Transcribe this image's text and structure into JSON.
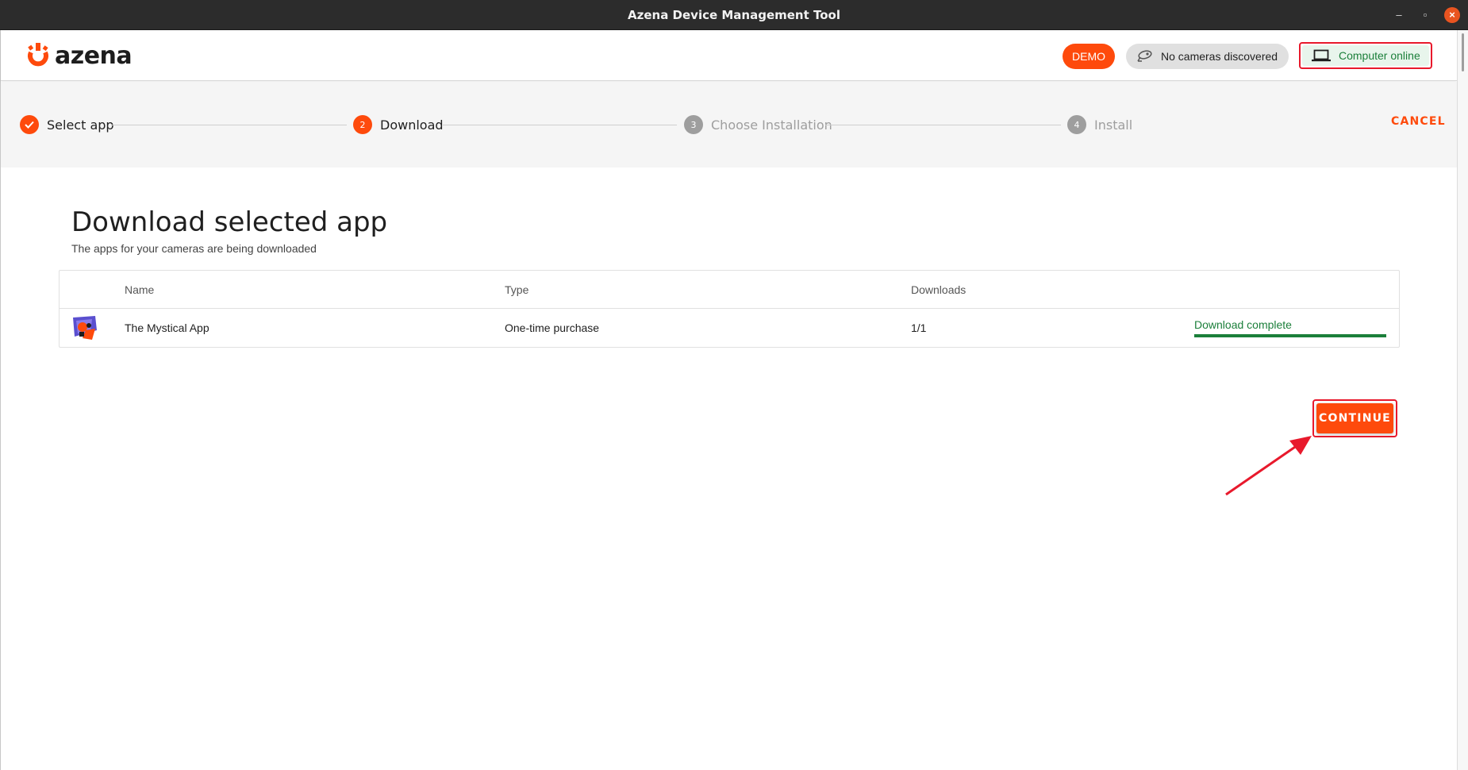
{
  "window": {
    "title": "Azena Device Management Tool",
    "controls": [
      "minimize-icon",
      "restore-icon",
      "close-icon"
    ]
  },
  "header": {
    "logo_text": "azena",
    "demo_label": "DEMO",
    "cameras_label": "No cameras discovered",
    "computer_label": "Computer online",
    "icons": {
      "camera": "camera-icon",
      "computer": "laptop-icon"
    }
  },
  "stepper": {
    "steps": [
      {
        "label": "Select app",
        "number": "1",
        "state": "done"
      },
      {
        "label": "Download",
        "number": "2",
        "state": "active"
      },
      {
        "label": "Choose Installation",
        "number": "3",
        "state": "todo"
      },
      {
        "label": "Install",
        "number": "4",
        "state": "todo"
      }
    ],
    "cancel_label": "CANCEL"
  },
  "main": {
    "title": "Download selected app",
    "subtitle": "The apps for your cameras are being downloaded",
    "table": {
      "headers": {
        "name": "Name",
        "type": "Type",
        "downloads": "Downloads"
      },
      "rows": [
        {
          "name": "The Mystical App",
          "type": "One-time purchase",
          "downloads": "1/1",
          "status": "Download complete",
          "progress_percent": 100
        }
      ]
    },
    "continue_label": "CONTINUE"
  },
  "colors": {
    "brand": "#fe4a0c",
    "success": "#1b7f3a",
    "highlight": "#e8192c"
  }
}
